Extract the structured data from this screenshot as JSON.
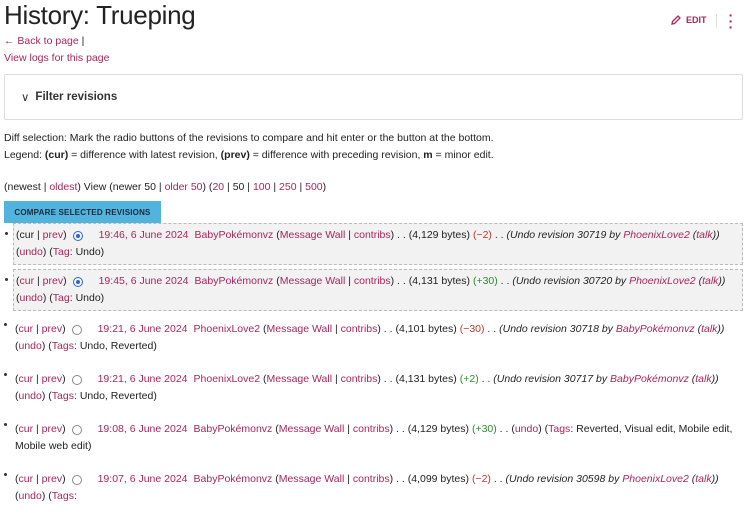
{
  "header": {
    "title": "History: Trueping",
    "edit_label": "EDIT",
    "back_label": "Back to page",
    "logs_label": "View logs for this page"
  },
  "filter": {
    "label": "Filter revisions"
  },
  "intro": {
    "diff_selection": "Diff selection: Mark the radio buttons of the revisions to compare and hit enter or the button at the bottom.",
    "legend_prefix": "Legend: ",
    "cur": "(cur)",
    "cur_desc": " = difference with latest revision, ",
    "prev": "(prev)",
    "prev_desc": " = difference with preceding revision, ",
    "m": "m",
    "m_desc": " = minor edit."
  },
  "nav": {
    "newest": "newest",
    "oldest": "oldest",
    "view": "View",
    "newer": "newer 50",
    "older": "older 50",
    "limits": [
      "20",
      "50",
      "100",
      "250",
      "500"
    ]
  },
  "compare_button": "COMPARE SELECTED REVISIONS",
  "colors": {
    "link": "#a8265e",
    "button": "#52b3dd",
    "negative": "#c0392b",
    "positive": "#2e8b2e"
  },
  "revisions": [
    {
      "cur_link": false,
      "selected": true,
      "highlight": true,
      "date": "19:46, 6 June 2024",
      "user": "BabyPokémonvz",
      "bytes": "4,129 bytes",
      "diff": "−2",
      "summary": "Undo revision 30719 by",
      "summary_user": "PhoenixLove2",
      "tag_label": "Tag",
      "tags": "Undo"
    },
    {
      "cur_link": true,
      "selected": true,
      "highlight": true,
      "date": "19:45, 6 June 2024",
      "user": "BabyPokémonvz",
      "bytes": "4,131 bytes",
      "diff": "+30",
      "summary": "Undo revision 30720 by",
      "summary_user": "PhoenixLove2",
      "tag_label": "Tag",
      "tags": "Undo"
    },
    {
      "cur_link": true,
      "selected": false,
      "date": "19:21, 6 June 2024",
      "user": "PhoenixLove2",
      "bytes": "4,101 bytes",
      "diff": "−30",
      "summary": "Undo revision 30718 by",
      "summary_user": "BabyPokémonvz",
      "tag_label": "Tags",
      "tags": "Undo, Reverted"
    },
    {
      "cur_link": true,
      "selected": false,
      "date": "19:21, 6 June 2024",
      "user": "PhoenixLove2",
      "bytes": "4,131 bytes",
      "diff": "+2",
      "summary": "Undo revision 30717 by",
      "summary_user": "BabyPokémonvz",
      "tag_label": "Tags",
      "tags": "Undo, Reverted"
    },
    {
      "cur_link": true,
      "selected": false,
      "date": "19:08, 6 June 2024",
      "user": "BabyPokémonvz",
      "bytes": "4,129 bytes",
      "diff": "+30",
      "summary": "",
      "summary_user": "",
      "tag_label": "Tags",
      "tags": "Reverted, Visual edit, Mobile edit, Mobile web edit"
    },
    {
      "cur_link": true,
      "selected": false,
      "date": "19:07, 6 June 2024",
      "user": "BabyPokémonvz",
      "bytes": "4,099 bytes",
      "diff": "−2",
      "summary": "Undo revision 30598 by",
      "summary_user": "PhoenixLove2",
      "tag_label": "Tags",
      "tags": ""
    }
  ],
  "labels": {
    "cur": "cur",
    "prev": "prev",
    "message_wall": "Message Wall",
    "contribs": "contribs",
    "talk": "talk",
    "undo": "undo"
  }
}
